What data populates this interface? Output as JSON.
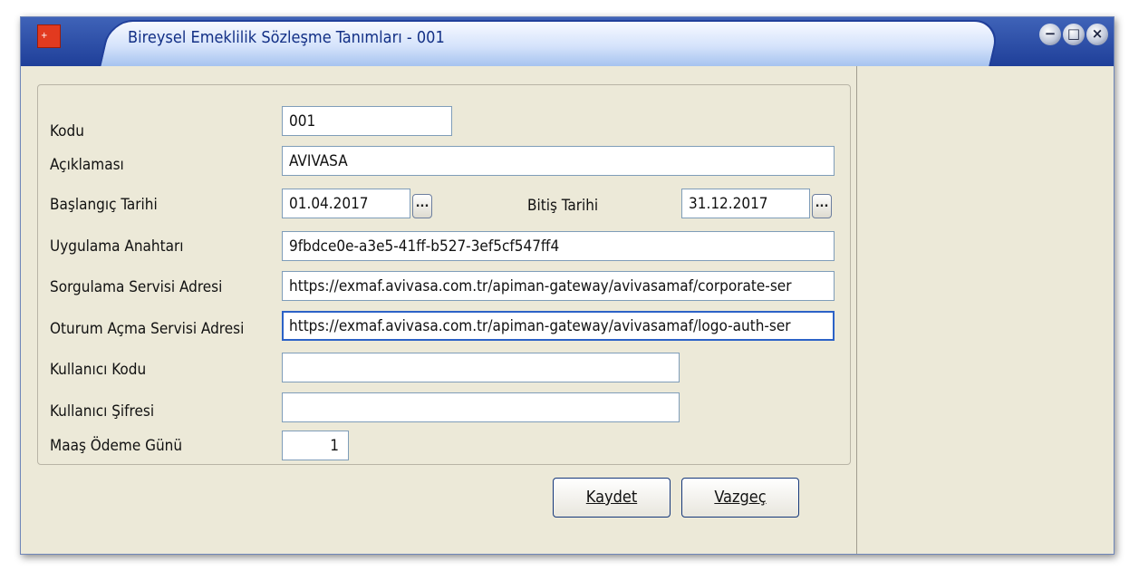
{
  "window": {
    "title": "Bireysel Emeklilik Sözleşme Tanımları - 001"
  },
  "controls": {
    "minimize": "−",
    "restore": "□",
    "close": "×"
  },
  "form": {
    "kodu": {
      "label": "Kodu",
      "value": "001"
    },
    "aciklama": {
      "label": "Açıklaması",
      "value": "AVIVASA"
    },
    "baslangic": {
      "label": "Başlangıç Tarihi",
      "value": "01.04.2017"
    },
    "bitis": {
      "label": "Bitiş Tarihi",
      "value": "31.12.2017"
    },
    "uygulama": {
      "label": "Uygulama Anahtarı",
      "value": "9fbdce0e-a3e5-41ff-b527-3ef5cf547ff4"
    },
    "sorgulama": {
      "label": "Sorgulama Servisi Adresi",
      "value": "https://exmaf.avivasa.com.tr/apiman-gateway/avivasamaf/corporate-ser"
    },
    "oturum": {
      "label": "Oturum Açma Servisi Adresi",
      "value": "https://exmaf.avivasa.com.tr/apiman-gateway/avivasamaf/logo-auth-ser"
    },
    "kullanici_kodu": {
      "label": "Kullanıcı Kodu",
      "value": ""
    },
    "kullanici_sifresi": {
      "label": "Kullanıcı Şifresi",
      "value": ""
    },
    "maas_odeme": {
      "label": "Maaş Ödeme Günü",
      "value": "1"
    },
    "ellipsis": "..."
  },
  "buttons": {
    "kaydet": "Kaydet",
    "vazgec": "Vazgeç"
  }
}
